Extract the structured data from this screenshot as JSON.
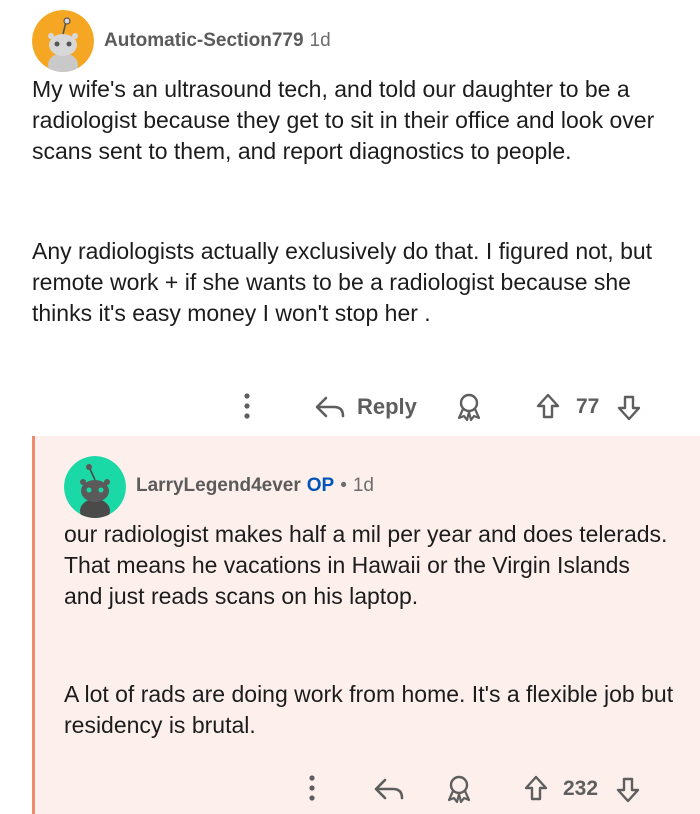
{
  "comment": {
    "username": "Automatic-Section779",
    "age": "1d",
    "paragraphs": [
      "My wife's an ultrasound tech, and told our daughter to be a radiologist because they get to sit in their office and look over scans sent to them, and report diagnostics to people.",
      "Any radiologists actually exclusively do that. I figured not, but remote work + if she wants to be a radiologist because she thinks it's easy money I won't stop her ."
    ],
    "reply_label": "Reply",
    "votes": "77",
    "avatar_color": "#f5a623"
  },
  "reply": {
    "username": "LarryLegend4ever",
    "op_badge": "OP",
    "separator": "•",
    "age": "1d",
    "paragraphs": [
      "our radiologist makes half a mil per year and does telerads. That means he vacations in Hawaii or the Virgin Islands and just reads scans on his laptop.",
      "A lot of rads are doing work from home. It's a flexible job but residency is brutal."
    ],
    "votes": "232",
    "avatar_color": "#1ad9a6",
    "thread_line_color": "#ef8a6f"
  },
  "icons": [
    "more-options-icon",
    "reply-arrow-icon",
    "award-icon",
    "upvote-icon",
    "downvote-icon"
  ]
}
